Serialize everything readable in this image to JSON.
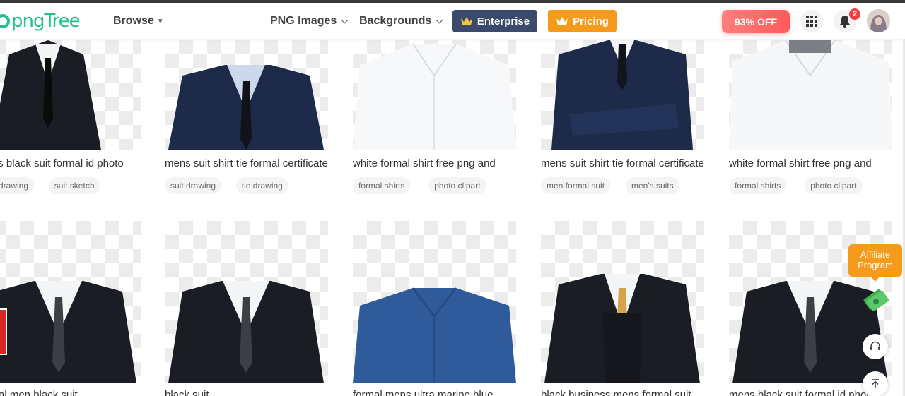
{
  "header": {
    "logo_text": "pngTree",
    "browse_label": "Browse",
    "png_images_label": "PNG Images",
    "backgrounds_label": "Backgrounds",
    "enterprise_label": "Enterprise",
    "pricing_label": "Pricing",
    "discount_label": "93% OFF",
    "notification_count": "2"
  },
  "colors": {
    "brand_green": "#22c08a",
    "enterprise_bg": "#3b4a6b",
    "pricing_bg": "#f59a1b",
    "discount_bg": "#ff5a5a"
  },
  "cards_row1": [
    {
      "title": "mens black suit formal id photo",
      "tags": [
        "suit drawing",
        "suit sketch"
      ]
    },
    {
      "title": "mens suit shirt tie formal certificate",
      "tags": [
        "suit drawing",
        "tie drawing"
      ]
    },
    {
      "title": "white formal shirt free png and",
      "tags": [
        "formal shirts",
        "photo clipart"
      ]
    },
    {
      "title": "mens suit shirt tie formal certificate",
      "tags": [
        "men formal suit",
        "men's suits"
      ]
    },
    {
      "title": "white formal shirt free png and",
      "tags": [
        "formal shirts",
        "photo clipart"
      ]
    }
  ],
  "cards_row2": [
    {
      "title": "formal men black suit"
    },
    {
      "title": "black suit"
    },
    {
      "title": "formal mens ultra marine blue"
    },
    {
      "title": "black business mens formal suit"
    },
    {
      "title": "mens black suit formal id photo"
    }
  ],
  "side": {
    "affiliate_line1": "Affiliate",
    "affiliate_line2": "Program"
  }
}
